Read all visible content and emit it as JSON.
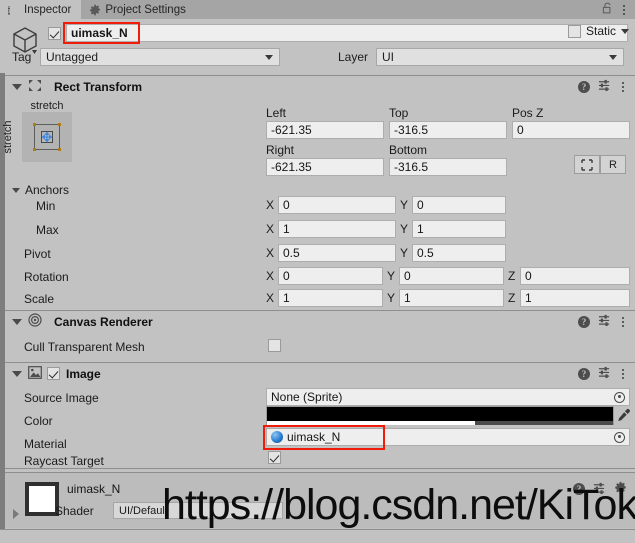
{
  "window": {
    "tabs": [
      {
        "label": "Inspector",
        "icon": "info-icon",
        "active": true
      },
      {
        "label": "Project Settings",
        "icon": "gear-icon",
        "active": false
      }
    ],
    "lock_icon": "lock-open-icon",
    "menu_icon": "kebab-menu-icon"
  },
  "object_header": {
    "enabled_checkbox": true,
    "name": "uimask_N",
    "static_label": "Static",
    "static_checked": false,
    "tag_label": "Tag",
    "tag_value": "Untagged",
    "layer_label": "Layer",
    "layer_value": "UI",
    "highlight_color": "#f01c09"
  },
  "rect_transform": {
    "title": "Rect Transform",
    "anchor_preset": {
      "top_label": "stretch",
      "left_label": "stretch"
    },
    "fields": [
      {
        "label": "Left",
        "value": "-621.35"
      },
      {
        "label": "Top",
        "value": "-316.5"
      },
      {
        "label": "Pos Z",
        "value": "0"
      },
      {
        "label": "Right",
        "value": "-621.35"
      },
      {
        "label": "Bottom",
        "value": "-316.5"
      }
    ],
    "blueprint_button": "",
    "raw_button": "R",
    "anchors_label": "Anchors",
    "anchors": [
      {
        "label": "Min",
        "x_axis": "X",
        "x": "0",
        "y_axis": "Y",
        "y": "0"
      },
      {
        "label": "Max",
        "x_axis": "X",
        "x": "1",
        "y_axis": "Y",
        "y": "1"
      }
    ],
    "pivot": {
      "label": "Pivot",
      "x_axis": "X",
      "x": "0.5",
      "y_axis": "Y",
      "y": "0.5"
    },
    "rotation": {
      "label": "Rotation",
      "x_axis": "X",
      "x": "0",
      "y_axis": "Y",
      "y": "0",
      "z_axis": "Z",
      "z": "0"
    },
    "scale": {
      "label": "Scale",
      "x_axis": "X",
      "x": "1",
      "y_axis": "Y",
      "y": "1",
      "z_axis": "Z",
      "z": "1"
    }
  },
  "canvas_renderer": {
    "title": "Canvas Renderer",
    "cull_label": "Cull Transparent Mesh",
    "cull_checked": false
  },
  "image": {
    "title": "Image",
    "enabled": true,
    "source_image_label": "Source Image",
    "source_image_value": "None (Sprite)",
    "color_label": "Color",
    "color_value": "#000000",
    "color_alpha_percent": 60,
    "material_label": "Material",
    "material_value": "uimask_N",
    "raycast_label": "Raycast Target",
    "raycast_checked": true
  },
  "material_preview": {
    "name": "uimask_N",
    "shader_label": "Shader",
    "shader_value": "UI/Default"
  },
  "watermark": {
    "text": "https://blog.csdn.net/KiTok"
  }
}
